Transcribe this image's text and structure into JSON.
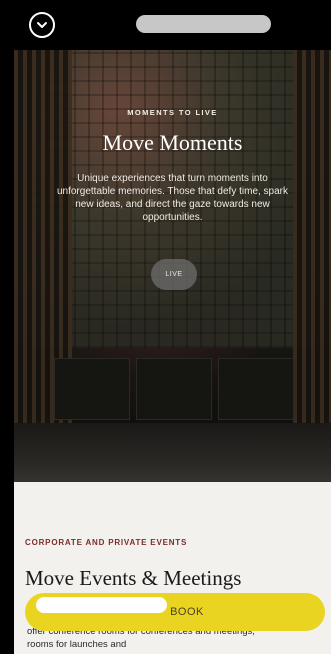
{
  "header": {
    "collapse_icon": "chevron-down-icon"
  },
  "hero": {
    "eyebrow": "MOMENTS TO LIVE",
    "title": "Move Moments",
    "description": "Unique experiences that turn moments into unforgettable memories. Those that defy time, spark new ideas, and direct the gaze towards new opportunities.",
    "live_label": "LIVE"
  },
  "section": {
    "eyebrow": "CORPORATE AND PRIVATE EVENTS",
    "title": "Move Events & Meetings",
    "text": "offer conference rooms for conferences and meetings, rooms for launches and"
  },
  "cta": {
    "book_label": "BOOK"
  },
  "colors": {
    "accent_yellow": "#e9d521",
    "eyebrow_red": "#7b2d2b",
    "panel_bg": "#f3f1ee"
  }
}
